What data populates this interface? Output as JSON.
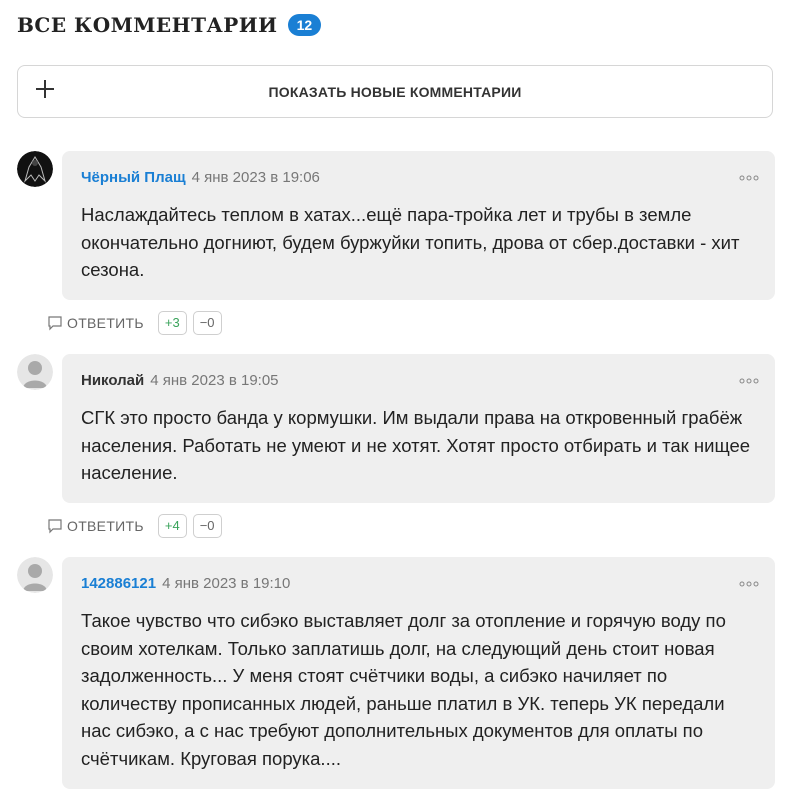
{
  "header": {
    "title": "ВСЕ КОММЕНТАРИИ",
    "count": "12"
  },
  "show_new": {
    "label": "ПОКАЗАТЬ НОВЫЕ КОММЕНТАРИИ"
  },
  "colors": {
    "accent": "#1a7fd4",
    "bubble": "#efefef",
    "plus_vote": "#3aa35b"
  },
  "comments": [
    {
      "author": "Чёрный Плащ",
      "time": "4 янв 2023 в 19:06",
      "text": "Наслаждайтесь теплом в хатах...ещё пара-тройка лет и трубы в земле окончательно догниют, будем буржуйки топить, дрова от сбер.доставки - хит сезона.",
      "reply": "ОТВЕТИТЬ",
      "plus": "+3",
      "minus": "−0",
      "avatar": "dark-figure-avatar"
    },
    {
      "author": "Николай",
      "time": "4 янв 2023 в 19:05",
      "text": "СГК это просто банда у кормушки. Им выдали права на откровенный грабёж населения. Работать не умеют и не хотят. Хотят просто отбирать и так нищее население.",
      "reply": "ОТВЕТИТЬ",
      "plus": "+4",
      "minus": "−0",
      "avatar": "default-user-avatar"
    },
    {
      "author": "142886121",
      "time": "4 янв 2023 в 19:10",
      "text": "Такое чувство что сибэко выставляет долг за отопление и горячую воду по своим хотелкам. Только заплатишь долг, на следующий день стоит новая задолженность... У меня стоят счётчики воды, а сибэко начиляет по количеству прописанных людей, раньше платил в УК. теперь УК передали нас сибэко, а с нас требуют дополнительных документов для оплаты по счётчикам. Круговая порука....",
      "avatar": "default-user-avatar"
    }
  ]
}
